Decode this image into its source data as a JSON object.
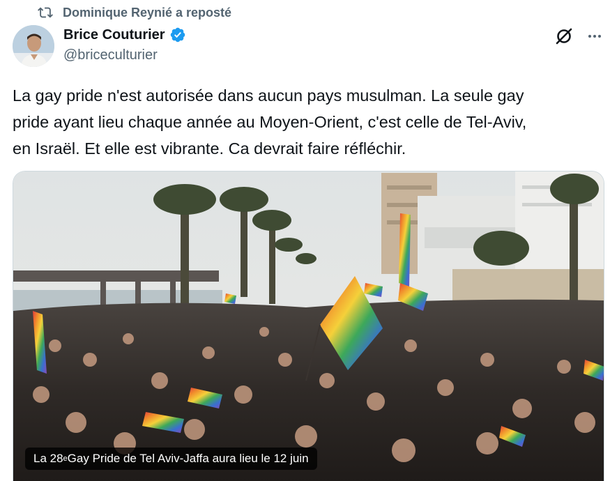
{
  "repost": {
    "text": "Dominique Reynié a reposté",
    "icon": "repost-icon"
  },
  "author": {
    "name": "Brice Couturier",
    "handle": "@briceculturier",
    "verified": true,
    "verified_color": "#1d9bf0"
  },
  "actions": {
    "grok_icon": "grok-icon",
    "more_icon": "more-icon"
  },
  "tweet": {
    "lines": [
      "La gay pride n'est autorisée dans aucun pays musulman. La seule gay",
      "pride ayant lieu chaque année au Moyen-Orient, c'est celle de Tel-Aviv,",
      "en Israël. Et elle est vibrante. Ca devrait faire réfléchir."
    ]
  },
  "media": {
    "caption_before": "La 28",
    "caption_sup": "e",
    "caption_after": " Gay Pride de Tel Aviv-Jaffa aura lieu le 12 juin"
  },
  "colors": {
    "text": "#0f1419",
    "secondary": "#536471"
  }
}
